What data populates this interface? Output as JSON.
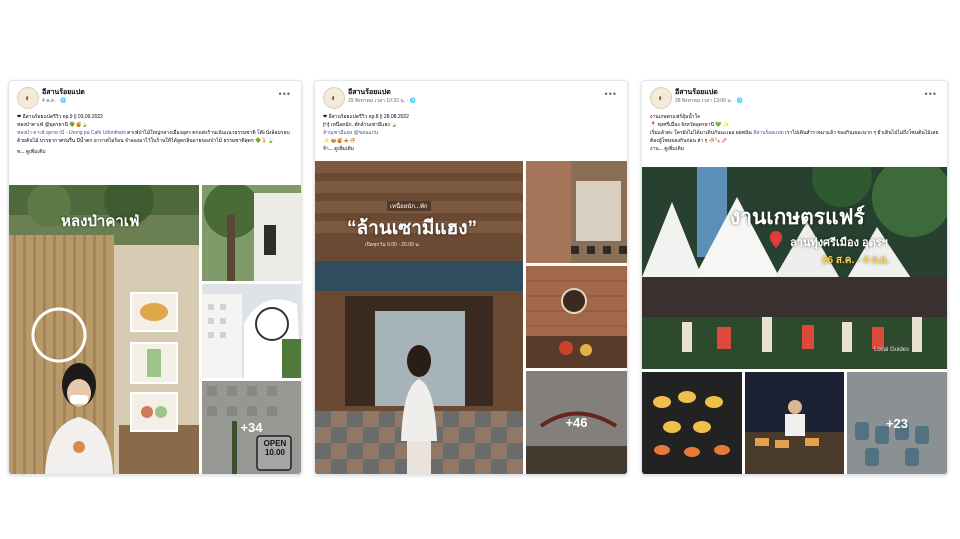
{
  "posts": [
    {
      "page_name": "อีสานร้อยแปด",
      "meta": "4 พ.ค. · 🌐",
      "caption": "❤ อีสานร้อยแปดรีวิว ep.9 || 03.09.2022",
      "body1": "หลงป่าคาเฟ่ @อุดรธานี 🌳🍯🍃",
      "link": "หลงป่า คาเฟ่ อุดรธานี - Lhong pa Cafe Udonthani",
      "body2": "คาเฟ่ป่าไม้ใหญ่กลางเมืองอุดร ตกแต่งร้านเน้นแนวธรรมชาติ โต๊ะนั่งล้อมรอบด้วยต้นไม้ บรรยากาศร่มรื่น มีน้ำตก อากาศไม่ร้อน จำลองมาไว้ในร้านให้ได้สูดกลิ่นอายของป่าไม้ ธรรมชาติสุดๆ 🌳🍹🍃",
      "see_more": "ท... ดูเพิ่มเติม",
      "overlay_text": "หลงป่าคาเฟ่",
      "sign_open": "OPEN",
      "sign_hours": "10.00",
      "extra_count": "+34"
    },
    {
      "page_name": "อีสานร้อยแปด",
      "meta": "29 สิงหาคม เวลา 10:32 น. · 🌐",
      "caption": "❤ อีสานร้อยแปดรีวิว ep.8 || 28.08.2022",
      "body1": "🍽 เหนื่อยนัก..พักล้านเซามีแฮง 🍃",
      "link": "ล้านเซามีแฮง @ขอนแก่น",
      "body2": "✨ 🍲🍯🍝🍜",
      "see_more": "จ้า... ดูเพิ่มเติม",
      "overlay_small": "เหนื่อยนัก...พัก",
      "overlay_title": "“ล้านเซามีแฮง”",
      "overlay_sub": "เปิดทุกวัน 9.00 - 20.00 น.",
      "extra_count": "+46"
    },
    {
      "page_name": "อีสานร้อยแปด",
      "meta": "28 สิงหาคม เวลา 13:06 น. · 🌐",
      "caption": "งานเกษตรแฟร์อุ้มน้ำใจ",
      "body1": "📍 ทุ่งศรีเมือง จังหวัดอุดรธานี 💚 ✨",
      "body_pre": "เริ่มแล้วค่ะ ใครยังไม่ได้มาเดินกันนะเออ ผอพนัน",
      "link": "อีสานร้อยแปด",
      "body2": "เราไปเดินสำรวจมาแล้ว ของกินเยอะมาก ๆ ยั่วเดินไปไม่ถึงโซนต้นไม้เลย ต้องอู้โซนของกินก่อน ฮ่า ๆ 🍜🍡🥢",
      "see_more": "งาน... ดูเพิ่มเติม",
      "overlay_title": "งานเกษตรแฟร์",
      "overlay_place": "ลานทุ่งศรีเมือง อุดรฯ",
      "overlay_dates": "26 ส.ค. - 4 ก.ย.",
      "watermark": "Local Guides",
      "extra_count": "+23"
    }
  ]
}
